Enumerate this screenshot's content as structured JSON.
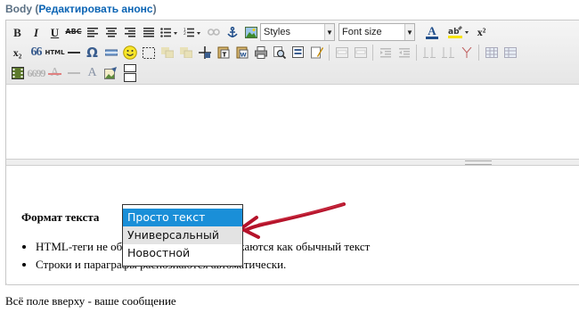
{
  "field": {
    "label": "Body",
    "open_paren": " (",
    "edit_link": "Редактировать анонс",
    "close_paren": ")"
  },
  "toolbar": {
    "row1": {
      "bold": "B",
      "italic": "I",
      "underline": "U",
      "strike": "ABC",
      "styles_combo": "Styles",
      "fontsize_combo": "Font size",
      "font_color": "A",
      "superscript": "x²"
    },
    "row2": {
      "subscript": "x₂",
      "blockquote": "66",
      "html": "HTML",
      "omega": "Ω"
    },
    "row3": {
      "quote": "6699",
      "remove_format": "A",
      "text_color": "A"
    }
  },
  "format_section": {
    "title": "Формат текста",
    "options": [
      "Просто текст",
      "Универсальный",
      "Новостной"
    ],
    "selected_index": 0,
    "hover_index": 1,
    "rules": [
      "HTML-теги не обрабатываются и отображаются как обычный текст",
      "Строки и параграфы распознаются автоматически."
    ]
  },
  "hint": "Всё поле вверху - ваше сообщение",
  "colors": {
    "accent_link": "#0a64b4",
    "selected": "#1a8fd8",
    "annotation_arrow": "#b5122a"
  }
}
